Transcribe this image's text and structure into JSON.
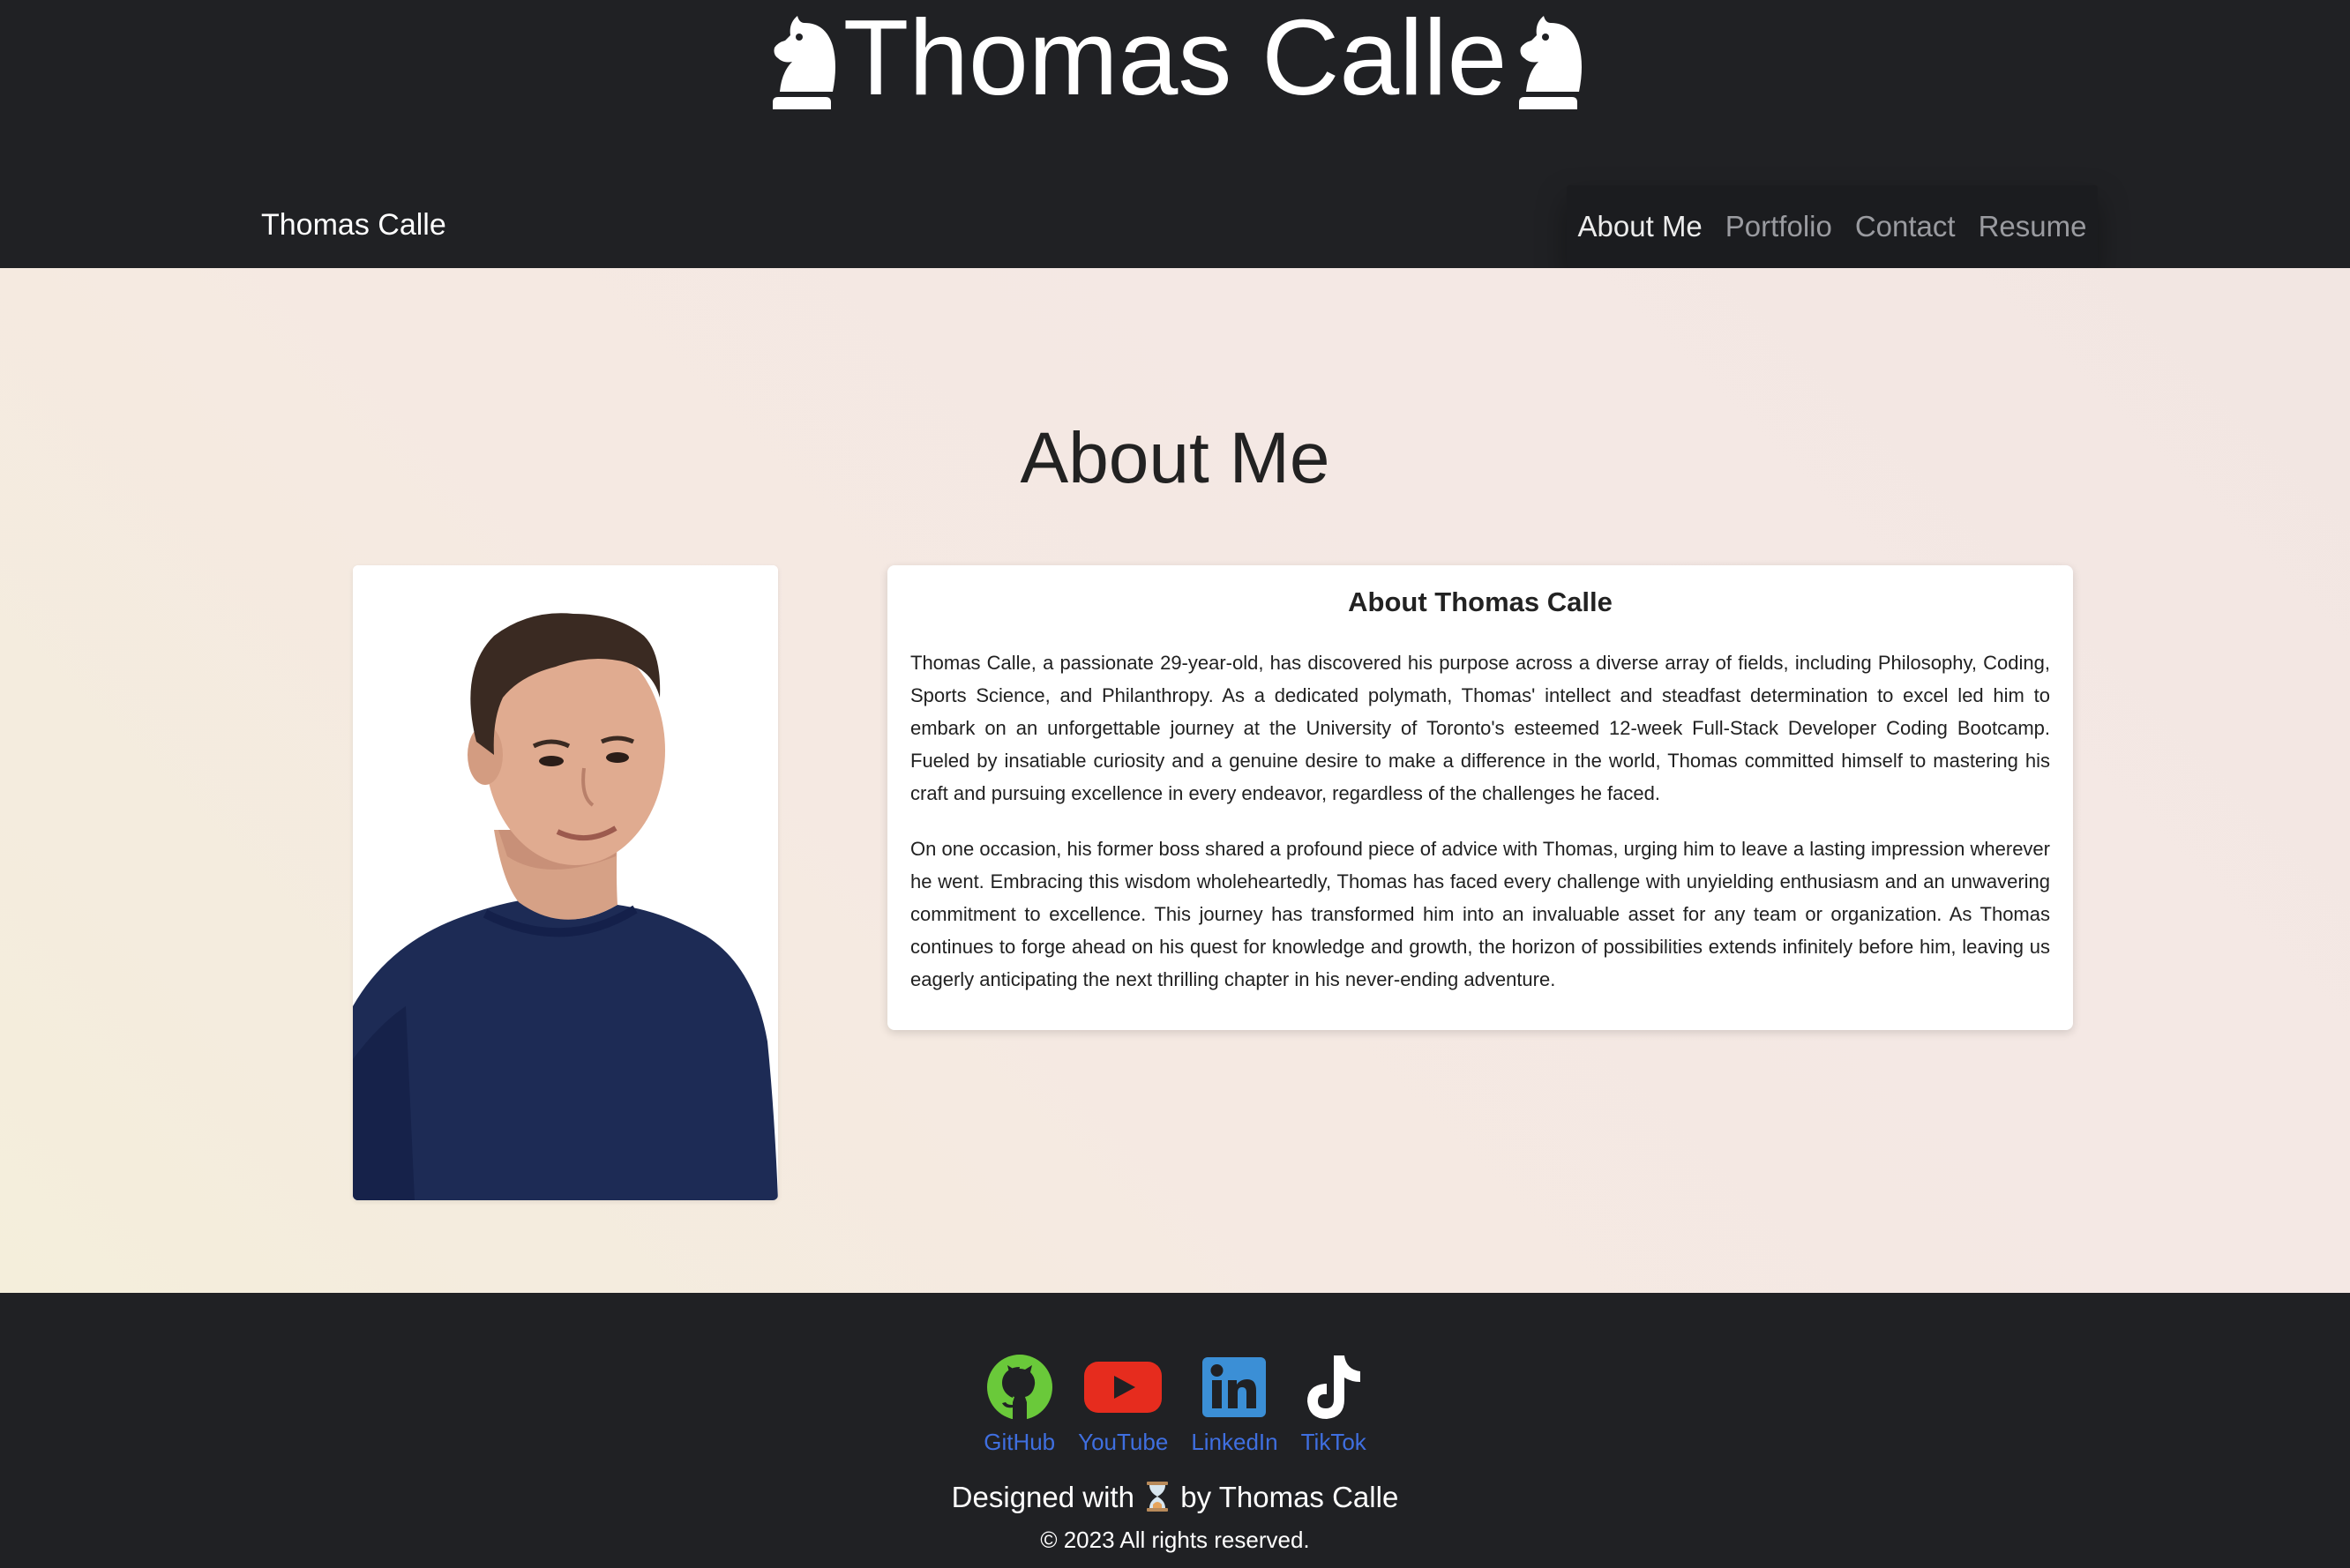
{
  "header": {
    "title": "Thomas Calle"
  },
  "nav": {
    "brand": "Thomas Calle",
    "links": [
      {
        "label": "About Me",
        "active": true
      },
      {
        "label": "Portfolio",
        "active": false
      },
      {
        "label": "Contact",
        "active": false
      },
      {
        "label": "Resume",
        "active": false
      }
    ]
  },
  "about": {
    "heading": "About Me",
    "card_title": "About Thomas Calle",
    "paragraphs": [
      "Thomas Calle, a passionate 29-year-old, has discovered his purpose across a diverse array of fields, including Philosophy, Coding, Sports Science, and Philanthropy. As a dedicated polymath, Thomas' intellect and steadfast determination to excel led him to embark on an unforgettable journey at the University of Toronto's esteemed 12-week Full-Stack Developer Coding Bootcamp. Fueled by insatiable curiosity and a genuine desire to make a difference in the world, Thomas committed himself to mastering his craft and pursuing excellence in every endeavor, regardless of the challenges he faced.",
      "On one occasion, his former boss shared a profound piece of advice with Thomas, urging him to leave a lasting impression wherever he went. Embracing this wisdom wholeheartedly, Thomas has faced every challenge with unyielding enthusiasm and an unwavering commitment to excellence. This journey has transformed him into an invaluable asset for any team or organization. As Thomas continues to forge ahead on his quest for knowledge and growth, the horizon of possibilities extends infinitely before him, leaving us eagerly anticipating the next thrilling chapter in his never-ending adventure."
    ]
  },
  "footer": {
    "socials": [
      {
        "label": "GitHub",
        "icon": "github-icon",
        "color": "#6ac93a"
      },
      {
        "label": "YouTube",
        "icon": "youtube-icon",
        "color": "#e62c1e"
      },
      {
        "label": "LinkedIn",
        "icon": "linkedin-icon",
        "color": "#3b8fd6"
      },
      {
        "label": "TikTok",
        "icon": "tiktok-icon",
        "color": "#ffffff"
      }
    ],
    "designed_prefix": "Designed with",
    "designed_icon": "hourglass-icon",
    "designed_suffix": "by Thomas Calle",
    "copyright": "© 2023 All rights reserved."
  },
  "colors": {
    "dark": "#202124",
    "link_blue": "#3f6fe0",
    "nav_inactive": "#9a9ba0"
  }
}
